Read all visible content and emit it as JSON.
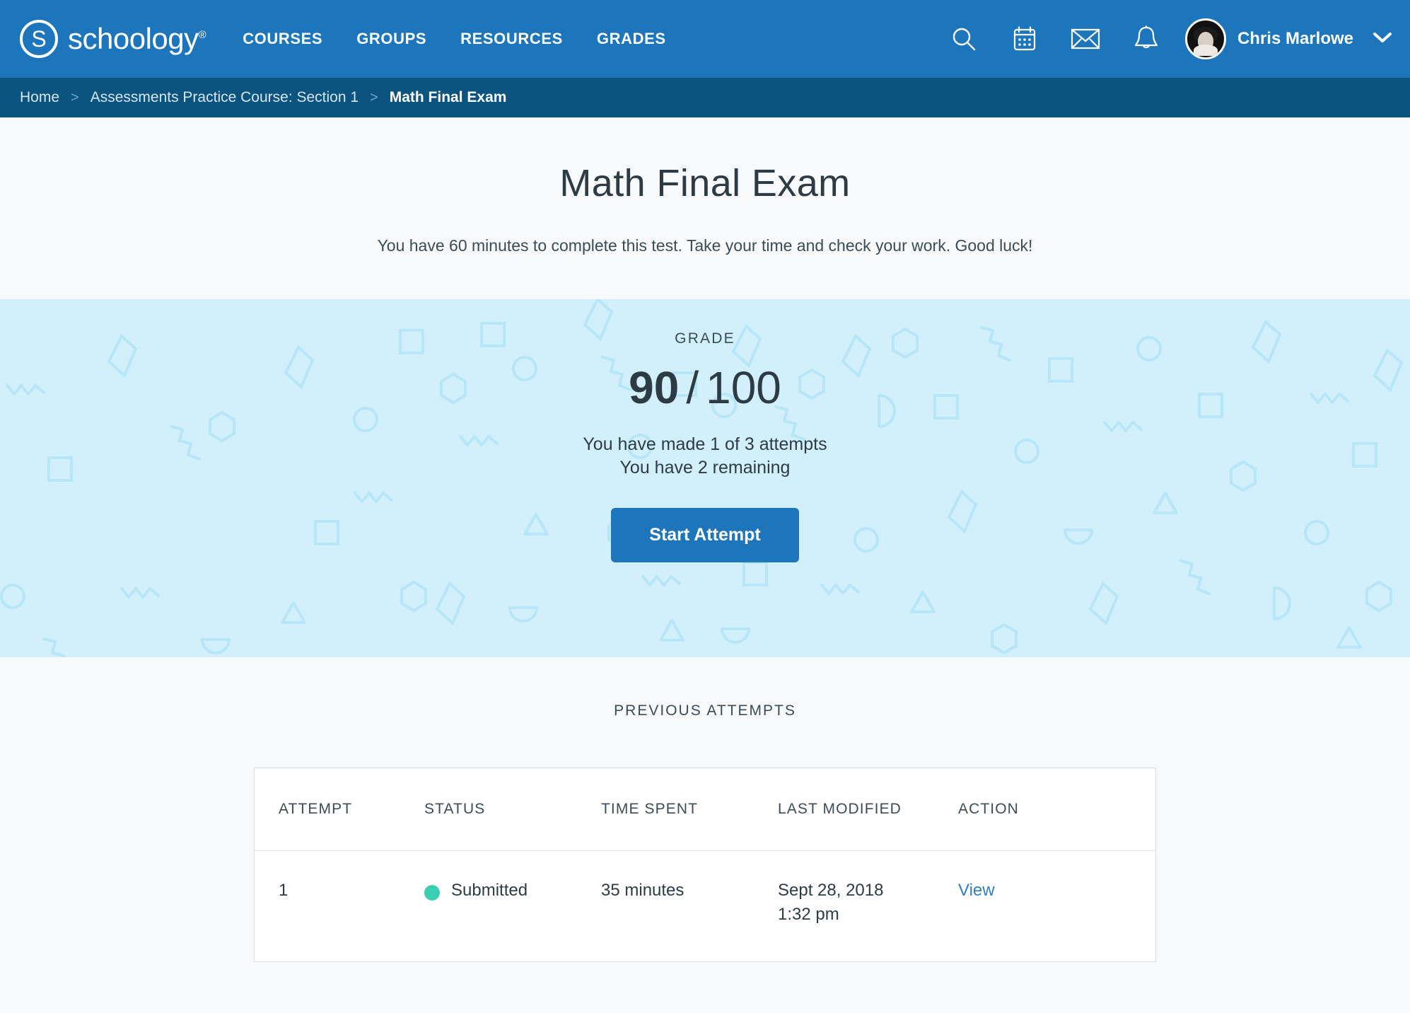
{
  "brand": {
    "name": "schoology",
    "logo_mark": "S",
    "registered_mark": "®",
    "accent_color": "#1d76bc",
    "breadcrumb_bar_color": "#0b5480",
    "banner_color": "#d2f0fc",
    "status_dot_color": "#3acfb0",
    "link_color": "#2f7fc1"
  },
  "topnav": {
    "links": [
      {
        "label": "COURSES",
        "name": "nav-courses"
      },
      {
        "label": "GROUPS",
        "name": "nav-groups"
      },
      {
        "label": "RESOURCES",
        "name": "nav-resources"
      },
      {
        "label": "GRADES",
        "name": "nav-grades"
      }
    ],
    "icons": [
      {
        "name": "search-icon",
        "label": "Search"
      },
      {
        "name": "calendar-icon",
        "label": "Calendar"
      },
      {
        "name": "mail-icon",
        "label": "Messages"
      },
      {
        "name": "bell-icon",
        "label": "Notifications"
      }
    ],
    "user": {
      "name": "Chris Marlowe",
      "avatar_name": "avatar",
      "chevron_icon": "chevron-down-icon"
    }
  },
  "breadcrumb": {
    "separator": ">",
    "items": [
      {
        "label": "Home",
        "current": false
      },
      {
        "label": "Assessments Practice Course: Section 1",
        "current": false
      },
      {
        "label": "Math Final Exam",
        "current": true
      }
    ]
  },
  "page": {
    "title": "Math Final Exam",
    "description": "You have 60 minutes to complete this test. Take your time and check your work. Good luck!"
  },
  "grade": {
    "label": "GRADE",
    "score": "90",
    "separator": "/",
    "total": "100",
    "attempts_made_line": "You have made 1 of 3 attempts",
    "attempts_remaining_line": "You have 2 remaining",
    "start_button_label": "Start Attempt"
  },
  "previous_attempts": {
    "heading": "PREVIOUS ATTEMPTS",
    "columns": [
      "ATTEMPT",
      "STATUS",
      "TIME SPENT",
      "LAST MODIFIED",
      "ACTION"
    ],
    "rows": [
      {
        "attempt": "1",
        "status": "Submitted",
        "time_spent": "35 minutes",
        "last_modified_date": "Sept 28, 2018",
        "last_modified_time": "1:32 pm",
        "action": "View"
      }
    ]
  }
}
